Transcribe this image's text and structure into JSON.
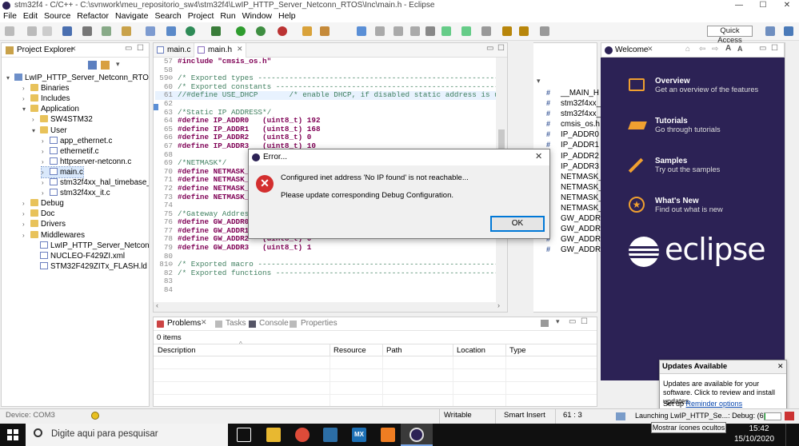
{
  "window": {
    "title": "stm32f4 - C/C++ - C:\\svnwork\\meu_repositorio_sw4\\stm32f4\\LwIP_HTTP_Server_Netconn_RTOS\\Inc\\main.h - Eclipse",
    "min": "—",
    "max": "☐",
    "close": "✕"
  },
  "menu": [
    "File",
    "Edit",
    "Source",
    "Refactor",
    "Navigate",
    "Search",
    "Project",
    "Run",
    "Window",
    "Help"
  ],
  "quick_access": "Quick Access",
  "project_explorer": {
    "tab": "Project Explorer",
    "items": [
      {
        "label": "LwIP_HTTP_Server_Netconn_RTOS",
        "chev": "▾",
        "icon": "proj"
      },
      {
        "label": "Binaries",
        "chev": "›",
        "icon": "folder"
      },
      {
        "label": "Includes",
        "chev": "›",
        "icon": "folder"
      },
      {
        "label": "Application",
        "chev": "▾",
        "icon": "folder"
      },
      {
        "label": "SW4STM32",
        "chev": "›",
        "icon": "folder"
      },
      {
        "label": "User",
        "chev": "▾",
        "icon": "folder"
      },
      {
        "label": "app_ethernet.c",
        "chev": "›",
        "icon": "cfile"
      },
      {
        "label": "ethernetif.c",
        "chev": "›",
        "icon": "cfile"
      },
      {
        "label": "httpserver-netconn.c",
        "chev": "›",
        "icon": "cfile"
      },
      {
        "label": "main.c",
        "chev": "›",
        "icon": "cfile"
      },
      {
        "label": "stm32f4xx_hal_timebase_tim.c",
        "chev": "›",
        "icon": "cfile"
      },
      {
        "label": "stm32f4xx_it.c",
        "chev": "›",
        "icon": "cfile"
      },
      {
        "label": "Debug",
        "chev": "›",
        "icon": "folder"
      },
      {
        "label": "Doc",
        "chev": "›",
        "icon": "folder"
      },
      {
        "label": "Drivers",
        "chev": "›",
        "icon": "folder"
      },
      {
        "label": "Middlewares",
        "chev": "›",
        "icon": "folder"
      },
      {
        "label": "LwIP_HTTP_Server_Netconn_RTOS Debug.launch",
        "chev": "",
        "icon": "cfile"
      },
      {
        "label": "NUCLEO-F429ZI.xml",
        "chev": "",
        "icon": "cfile"
      },
      {
        "label": "STM32F429ZITx_FLASH.ld",
        "chev": "",
        "icon": "cfile"
      }
    ]
  },
  "editor": {
    "tabs": [
      "main.c",
      "main.h"
    ],
    "lines": [
      {
        "n": "57",
        "t": "#include \"cmsis_os.h\""
      },
      {
        "n": "58",
        "t": ""
      },
      {
        "n": "59⊖",
        "t": "/* Exported types ------------------------------------------------------------*/"
      },
      {
        "n": "60",
        "t": "/* Exported constants --------------------------------------------------------*/"
      },
      {
        "n": "61",
        "t": "//#define USE_DHCP       /* enable DHCP, if disabled static address is used*/"
      },
      {
        "n": "62",
        "t": ""
      },
      {
        "n": "63",
        "t": "/*Static IP ADDRESS*/"
      },
      {
        "n": "64",
        "t": "#define IP_ADDR0   (uint8_t) 192"
      },
      {
        "n": "65",
        "t": "#define IP_ADDR1   (uint8_t) 168"
      },
      {
        "n": "66",
        "t": "#define IP_ADDR2   (uint8_t) 0"
      },
      {
        "n": "67",
        "t": "#define IP_ADDR3   (uint8_t) 10"
      },
      {
        "n": "68",
        "t": ""
      },
      {
        "n": "69",
        "t": "/*NETMASK*/"
      },
      {
        "n": "70",
        "t": "#define NETMASK_ADDR0   (uint8_t) 255"
      },
      {
        "n": "71",
        "t": "#define NETMASK_ADDR1   (uint8_t) 255"
      },
      {
        "n": "72",
        "t": "#define NETMASK_ADDR2   (uint8_t) 255"
      },
      {
        "n": "73",
        "t": "#define NETMASK_ADDR3   (uint8_t) 0"
      },
      {
        "n": "74",
        "t": ""
      },
      {
        "n": "75",
        "t": "/*Gateway Address*/"
      },
      {
        "n": "76",
        "t": "#define GW_ADDR0   (uint8_t) 192"
      },
      {
        "n": "77",
        "t": "#define GW_ADDR1   (uint8_t) 168"
      },
      {
        "n": "78",
        "t": "#define GW_ADDR2   (uint8_t) 0"
      },
      {
        "n": "79",
        "t": "#define GW_ADDR3   (uint8_t) 1"
      },
      {
        "n": "80",
        "t": ""
      },
      {
        "n": "81⊖",
        "t": "/* Exported macro ------------------------------------------------------------*/"
      },
      {
        "n": "82",
        "t": "/* Exported functions ---------------------------------------------------------*/"
      },
      {
        "n": "83",
        "t": ""
      },
      {
        "n": "84",
        "t": ""
      }
    ]
  },
  "outline": {
    "items": [
      "__MAIN_H",
      "stm32f4xx_",
      "stm32f4xx_",
      "cmsis_os.h",
      "IP_ADDR0",
      "IP_ADDR1",
      "IP_ADDR2",
      "IP_ADDR3",
      "NETMASK_",
      "NETMASK_",
      "NETMASK_",
      "NETMASK_",
      "GW_ADDR0",
      "GW_ADDR1",
      "GW_ADDR2",
      "GW_ADDR3"
    ]
  },
  "welcome": {
    "tab": "Welcome",
    "items": [
      {
        "title": "Overview",
        "sub": "Get an overview of the features",
        "icon": "book-icon"
      },
      {
        "title": "Tutorials",
        "sub": "Go through tutorials",
        "icon": "graduation-cap-icon"
      },
      {
        "title": "Samples",
        "sub": "Try out the samples",
        "icon": "magic-wand-icon"
      },
      {
        "title": "What's New",
        "sub": "Find out what is new",
        "icon": "star-icon"
      }
    ],
    "logo_text": "eclipse"
  },
  "error_dialog": {
    "title": "Error...",
    "message": "Configured inet address 'No IP found' is not reachable...",
    "detail": "Please update corresponding Debug Configuration.",
    "ok": "OK",
    "close": "✕"
  },
  "problems": {
    "tabs": [
      "Problems",
      "Tasks",
      "Console",
      "Properties"
    ],
    "count": "0 items",
    "columns": [
      "Description",
      "Resource",
      "Path",
      "Location",
      "Type"
    ]
  },
  "updates": {
    "title": "Updates Available",
    "body": "Updates are available for your software. Click to review and install updates.",
    "setup_prefix": "Set up ",
    "reminder_link": "Reminder options",
    "close": "✕"
  },
  "statusbar": {
    "device": "Device: COM3",
    "writable": "Writable",
    "insert": "Smart Insert",
    "position": "61 : 3",
    "launching": "Launching LwIP_HTTP_Se...: Debug: (6%)",
    "progress": 0.06,
    "tooltip": "Mostrar ícones ocultos"
  },
  "taskbar": {
    "search": "Digite aqui para pesquisar",
    "time": "15:42",
    "date": "15/10/2020"
  }
}
